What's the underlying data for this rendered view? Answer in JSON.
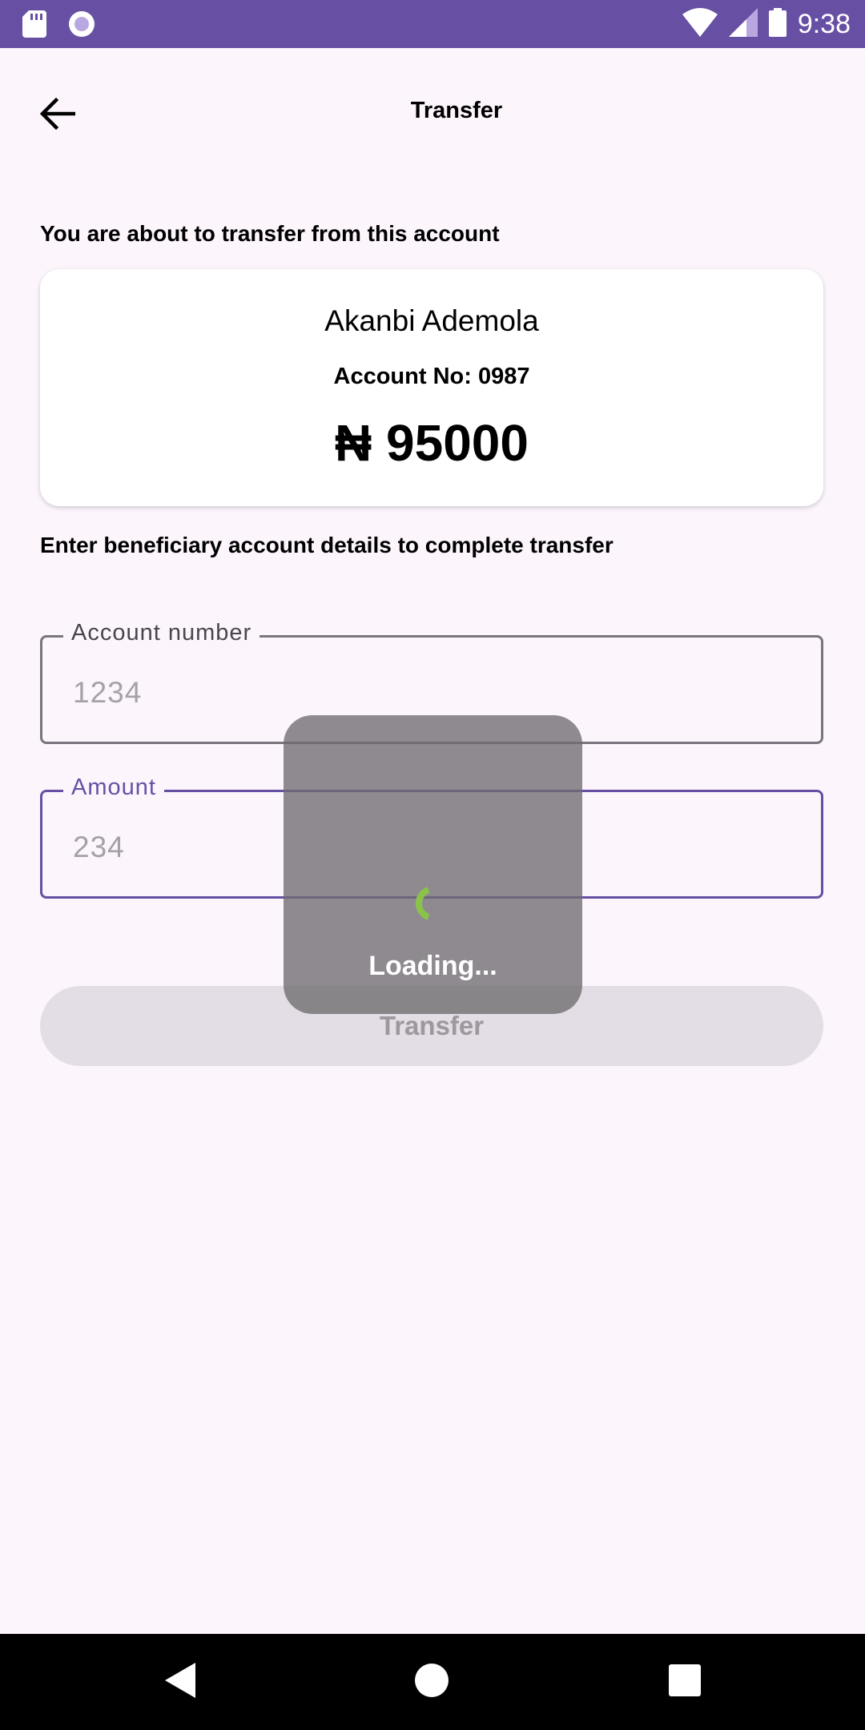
{
  "status_bar": {
    "time": "9:38",
    "icons": [
      "sd-card-icon",
      "radio-button-icon",
      "wifi-icon",
      "cell-signal-icon",
      "battery-icon"
    ]
  },
  "app_bar": {
    "title": "Transfer",
    "back_icon": "arrow-back-icon"
  },
  "source_section": {
    "label": "You are about to transfer from this account"
  },
  "account_card": {
    "name": "Akanbi Ademola",
    "account_no": "Account No: 0987",
    "balance": "₦ 95000"
  },
  "beneficiary_section": {
    "label": "Enter beneficiary account details to complete transfer"
  },
  "form": {
    "account_number": {
      "label": "Account number",
      "value": "1234"
    },
    "amount": {
      "label": "Amount",
      "value": "234"
    },
    "transfer_label": "Transfer"
  },
  "loading": {
    "text": "Loading..."
  },
  "nav_bar": {
    "icons": [
      "nav-back-icon",
      "nav-home-icon",
      "nav-recents-icon"
    ]
  },
  "colors": {
    "accent": "#6750A4",
    "background": "#FCF5FC",
    "spinner": "#8BC34A"
  }
}
